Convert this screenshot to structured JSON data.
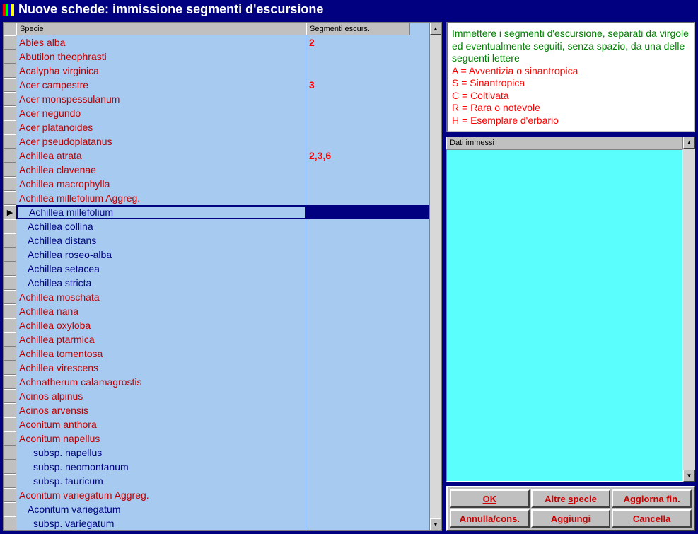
{
  "window": {
    "title": "Nuove schede: immissione segmenti d'escursione"
  },
  "grid": {
    "header_specie": "Specie",
    "header_segmenti": "Segmenti escurs.",
    "rows": [
      {
        "label": "Abies alba",
        "segmenti": "2",
        "indent": 0
      },
      {
        "label": "Abutilon theophrasti",
        "segmenti": "",
        "indent": 0
      },
      {
        "label": "Acalypha virginica",
        "segmenti": "",
        "indent": 0
      },
      {
        "label": "Acer campestre",
        "segmenti": "3",
        "indent": 0
      },
      {
        "label": "Acer monspessulanum",
        "segmenti": "",
        "indent": 0
      },
      {
        "label": "Acer negundo",
        "segmenti": "",
        "indent": 0
      },
      {
        "label": "Acer platanoides",
        "segmenti": "",
        "indent": 0
      },
      {
        "label": "Acer pseudoplatanus",
        "segmenti": "",
        "indent": 0
      },
      {
        "label": "Achillea atrata",
        "segmenti": "2,3,6",
        "indent": 0
      },
      {
        "label": "Achillea clavenae",
        "segmenti": "",
        "indent": 0
      },
      {
        "label": "Achillea macrophylla",
        "segmenti": "",
        "indent": 0
      },
      {
        "label": "Achillea millefolium Aggreg.",
        "segmenti": "",
        "indent": 0
      },
      {
        "label": "Achillea millefolium",
        "segmenti": "",
        "indent": 1,
        "selected": true
      },
      {
        "label": "Achillea collina",
        "segmenti": "",
        "indent": 1
      },
      {
        "label": "Achillea distans",
        "segmenti": "",
        "indent": 1
      },
      {
        "label": "Achillea roseo-alba",
        "segmenti": "",
        "indent": 1
      },
      {
        "label": "Achillea setacea",
        "segmenti": "",
        "indent": 1
      },
      {
        "label": "Achillea stricta",
        "segmenti": "",
        "indent": 1
      },
      {
        "label": "Achillea moschata",
        "segmenti": "",
        "indent": 0
      },
      {
        "label": "Achillea nana",
        "segmenti": "",
        "indent": 0
      },
      {
        "label": "Achillea oxyloba",
        "segmenti": "",
        "indent": 0
      },
      {
        "label": "Achillea ptarmica",
        "segmenti": "",
        "indent": 0
      },
      {
        "label": "Achillea tomentosa",
        "segmenti": "",
        "indent": 0
      },
      {
        "label": "Achillea virescens",
        "segmenti": "",
        "indent": 0
      },
      {
        "label": "Achnatherum calamagrostis",
        "segmenti": "",
        "indent": 0
      },
      {
        "label": "Acinos alpinus",
        "segmenti": "",
        "indent": 0
      },
      {
        "label": "Acinos arvensis",
        "segmenti": "",
        "indent": 0
      },
      {
        "label": "Aconitum anthora",
        "segmenti": "",
        "indent": 0
      },
      {
        "label": "Aconitum napellus",
        "segmenti": "",
        "indent": 0
      },
      {
        "label": "subsp. napellus",
        "segmenti": "",
        "indent": 2
      },
      {
        "label": "subsp. neomontanum",
        "segmenti": "",
        "indent": 2
      },
      {
        "label": "subsp. tauricum",
        "segmenti": "",
        "indent": 2
      },
      {
        "label": "Aconitum variegatum Aggreg.",
        "segmenti": "",
        "indent": 0
      },
      {
        "label": "Aconitum variegatum",
        "segmenti": "",
        "indent": 1
      },
      {
        "label": "subsp. variegatum",
        "segmenti": "",
        "indent": 2
      }
    ]
  },
  "info": {
    "intro": "Immettere i segmenti d'escursione, separati da virgole ed eventualmente seguiti, senza spazio, da una delle seguenti lettere",
    "lines": [
      "A = Avventizia o sinantropica",
      "S = Sinantropica",
      "C = Coltivata",
      "R = Rara o notevole",
      "H = Esemplare d'erbario"
    ]
  },
  "dati": {
    "header": "Dati immessi"
  },
  "buttons": {
    "ok": "OK",
    "altre_pre": "Altre ",
    "altre_ul": "s",
    "altre_post": "pecie",
    "aggiorna": "Aggiorna fin.",
    "annulla": "Annulla/cons.",
    "aggiungi_pre": "Aggi",
    "aggiungi_ul": "u",
    "aggiungi_post": "ngi",
    "cancella_ul": "C",
    "cancella_post": "ancella"
  }
}
